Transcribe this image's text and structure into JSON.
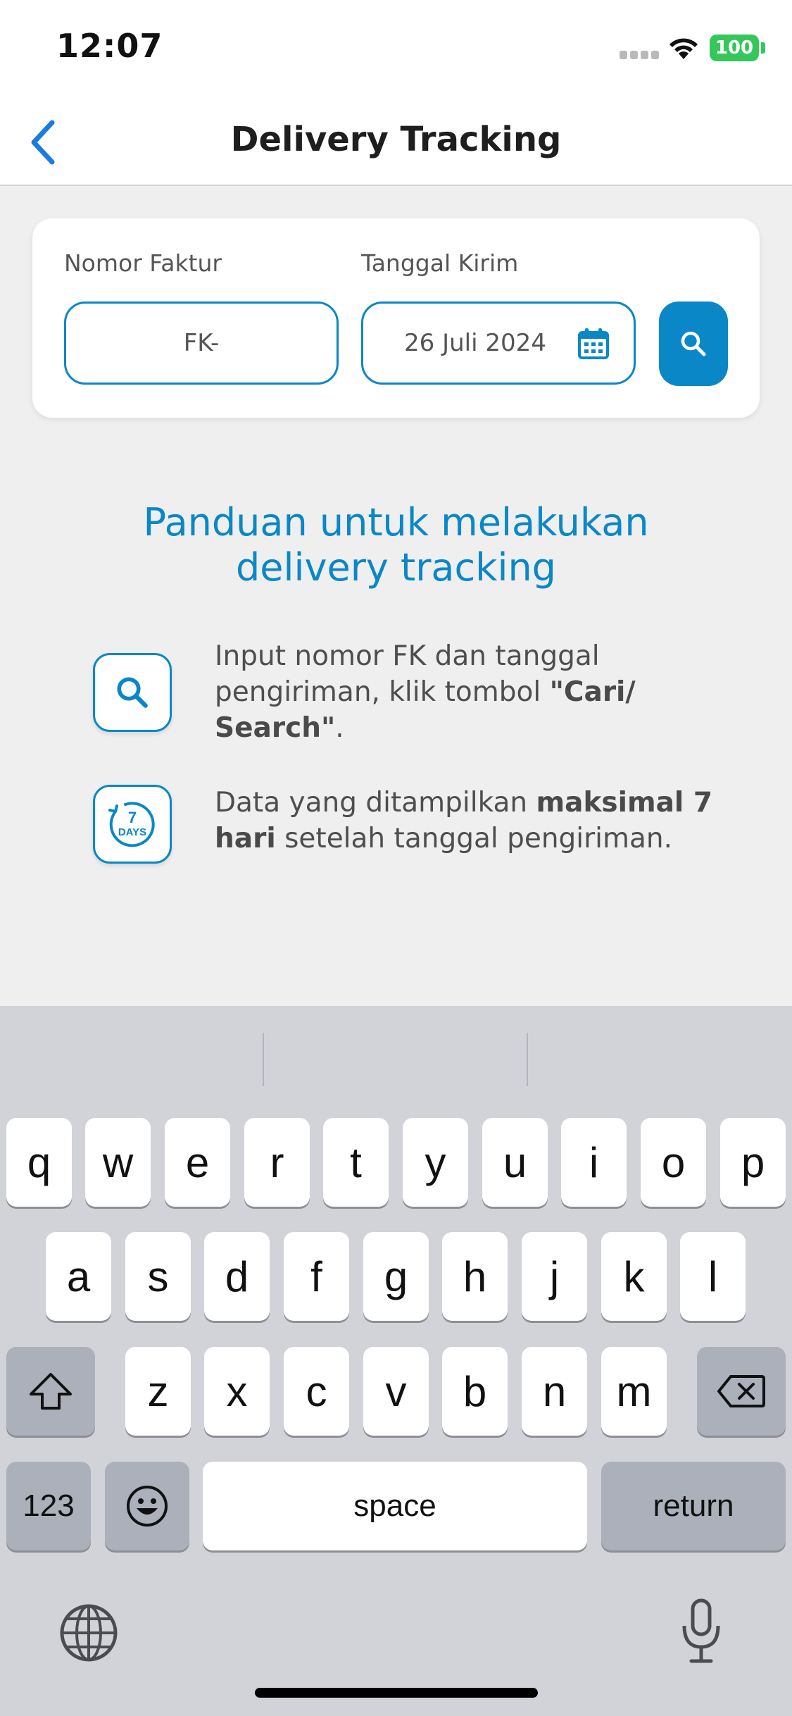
{
  "status_bar": {
    "time": "12:07",
    "battery": "100",
    "icons": [
      "signal-icon",
      "wifi-icon",
      "battery-icon"
    ]
  },
  "header": {
    "back_icon": "chevron-left-icon",
    "title": "Delivery Tracking"
  },
  "search_form": {
    "invoice_label": "Nomor Faktur",
    "invoice_value": "FK-",
    "date_label": "Tanggal Kirim",
    "date_value": "26 Juli 2024",
    "calendar_icon": "calendar-icon",
    "search_icon": "search-icon"
  },
  "guide": {
    "title": "Panduan untuk melakukan delivery tracking",
    "items": [
      {
        "icon": "search-icon",
        "text_1": "Input nomor FK dan tanggal pengiriman, klik tombol ",
        "text_bold": "\"Cari/ Search\"",
        "text_2": "."
      },
      {
        "icon": "seven-days-icon",
        "icon_number": "7",
        "icon_label": "DAYS",
        "text_1": "Data yang ditampilkan ",
        "text_bold": "maksimal 7 hari",
        "text_2": " setelah tanggal pengiriman."
      }
    ]
  },
  "keyboard": {
    "row1": [
      "q",
      "w",
      "e",
      "r",
      "t",
      "y",
      "u",
      "i",
      "o",
      "p"
    ],
    "row2": [
      "a",
      "s",
      "d",
      "f",
      "g",
      "h",
      "j",
      "k",
      "l"
    ],
    "row3": [
      "z",
      "x",
      "c",
      "v",
      "b",
      "n",
      "m"
    ],
    "numbers_key": "123",
    "space_key": "space",
    "return_key": "return",
    "icons": [
      "shift-icon",
      "delete-icon",
      "emoji-icon",
      "globe-icon",
      "microphone-icon"
    ]
  },
  "colors": {
    "accent": "#0A87C7",
    "battery": "#35C759",
    "keyboard_bg": "#D1D3D9"
  }
}
